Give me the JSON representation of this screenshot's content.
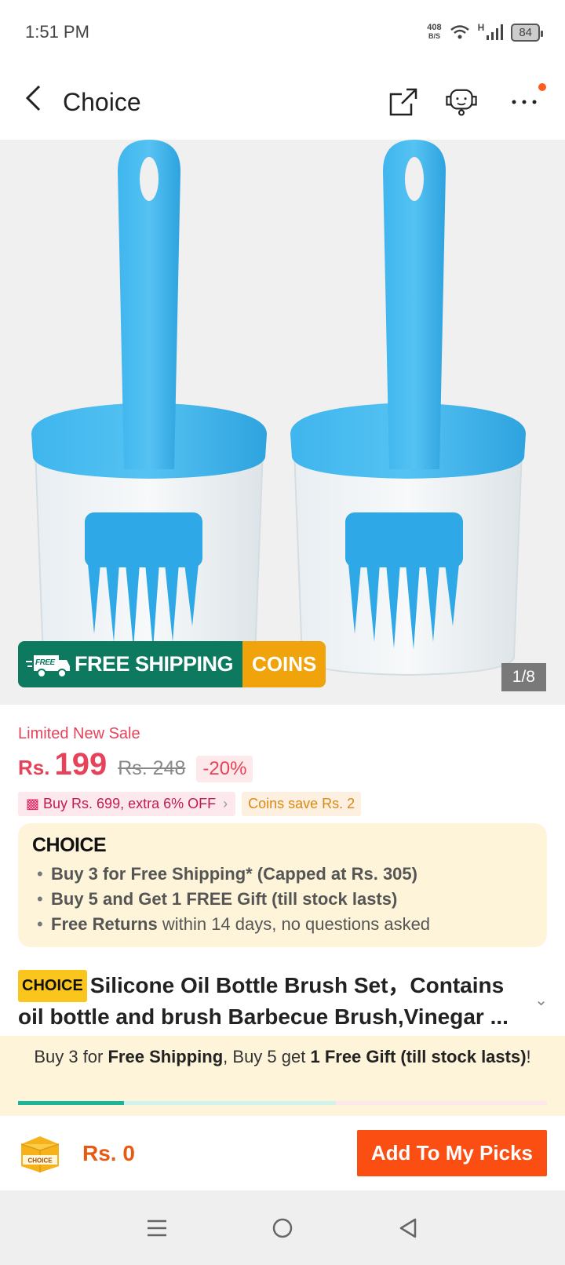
{
  "status": {
    "time": "1:51 PM",
    "net_speed": "408",
    "net_unit": "B/S",
    "net_type": "H",
    "battery": "84"
  },
  "header": {
    "title": "Choice"
  },
  "gallery": {
    "counter": "1/8",
    "banner_free_tag": "FREE",
    "banner_shipping": "FREE SHIPPING",
    "banner_coins": "COINS"
  },
  "pricing": {
    "sale_label": "Limited New Sale",
    "currency": "Rs.",
    "price": "199",
    "old_price": "Rs. 248",
    "discount": "-20%",
    "promo_bundle": "Buy Rs. 699, extra 6% OFF",
    "promo_coins": "Coins save Rs. 2"
  },
  "choice": {
    "logo": "CHOICE",
    "perks": [
      {
        "bold": "Buy 3 for  Free Shipping* (Capped at Rs. 305)",
        "rest": ""
      },
      {
        "bold": "Buy 5 and Get 1 FREE Gift (till stock lasts)",
        "rest": ""
      },
      {
        "bold": "Free Returns",
        "rest": " within 14 days, no questions asked"
      }
    ]
  },
  "product": {
    "tag": "CHOICE",
    "title": "Silicone Oil Bottle Brush Set，Contains oil bottle and brush Barbecue Brush,Vinegar ..."
  },
  "bundle": {
    "t1": "Buy 3 for ",
    "b1": "Free Shipping",
    "t2": ", Buy 5 get ",
    "b2": "1 Free Gift (till stock lasts)",
    "t3": "!"
  },
  "progress": {
    "value": 0.2
  },
  "bottom": {
    "box_label": "CHOICE",
    "amount": "Rs. 0",
    "button": "Add To My Picks"
  },
  "colors": {
    "accent": "#fa4e12",
    "price": "#e6435a",
    "shipping_green": "#0d7a5f",
    "choice_bg": "#fdf4d9",
    "brush_blue": "#3cb1ea"
  }
}
